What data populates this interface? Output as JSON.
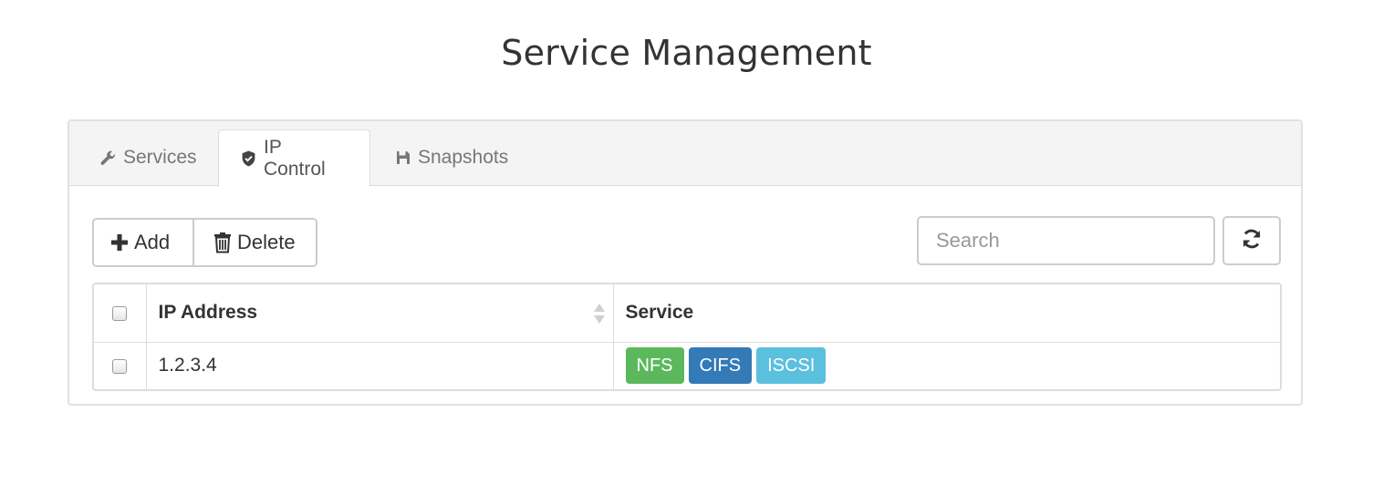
{
  "page": {
    "title": "Service Management"
  },
  "tabs": [
    {
      "label": "Services",
      "icon": "wrench-icon",
      "active": false
    },
    {
      "label": "IP Control",
      "icon": "shield-icon",
      "active": true
    },
    {
      "label": "Snapshots",
      "icon": "floppy-disk-icon",
      "active": false
    }
  ],
  "toolbar": {
    "add_label": "Add",
    "delete_label": "Delete",
    "search_placeholder": "Search",
    "search_value": ""
  },
  "table": {
    "headers": {
      "ip": "IP Address",
      "service": "Service"
    },
    "rows": [
      {
        "ip": "1.2.3.4",
        "services": [
          {
            "label": "NFS",
            "color": "#5cb85c"
          },
          {
            "label": "CIFS",
            "color": "#337ab7"
          },
          {
            "label": "ISCSI",
            "color": "#5bc0de"
          }
        ]
      }
    ]
  }
}
